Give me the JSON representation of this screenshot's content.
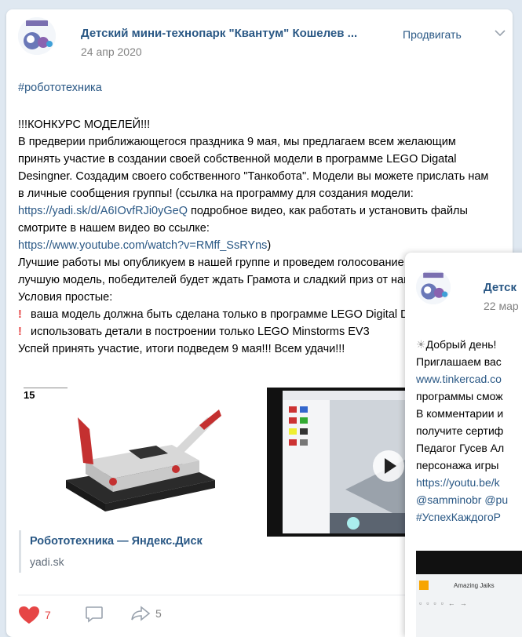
{
  "post1": {
    "author": "Детский мини-технопарк \"Квантум\" Кошелев ...",
    "date": "24 апр 2020",
    "promote_label": "Продвигать",
    "hashtag": "#робототехника",
    "title": "!!!КОНКУРС МОДЕЛЕЙ!!!",
    "para1": "В предверии приближающегося праздника 9 мая, мы предлагаем всем желающим принять участие в создании своей собственной модели в программе LEGO Digatal Desingner. Создадим своего собственного \"Танкобота\". Модели вы можете прислать нам в личные сообщения группы! (ссылка на программу для создания модели: ",
    "link1": "https://yadi.sk/d/A6IOvfRJi0yGeQ",
    "para1b": " подробное видео, как работать и установить файлы смотрите в нашем видео во ссылке:",
    "link2": "https://www.youtube.com/watch?v=RMff_SsRYns",
    "para1c": ")",
    "para2": "Лучшие работы мы опубликуем в нашей группе и проведем голосование за самую лучшую модель, победителей будет ждать Грамота и сладкий приз от нашей команды.",
    "conditions": "Условия простые:",
    "cond1": "ваша модель должна быть сделана только в программе LEGO Digital Designer",
    "cond2": "использовать детали в построении только LEGO Minstorms EV3",
    "closing": "Успей принять участие, итоги подведем 9 мая!!! Всем удачи!!!",
    "robot_label": "15",
    "snippet_title": "Робототехника — Яндекс.Диск",
    "snippet_domain": "yadi.sk",
    "likes": "7",
    "shares": "5",
    "accent": "#2a5885",
    "like_color": "#e64646"
  },
  "post2": {
    "author": "Детск",
    "date": "22 мар",
    "lines": [
      "Добрый день!",
      "Приглашаем вас",
      "www.tinkercad.co",
      "программы смож",
      "В комментарии и",
      "получите сертиф",
      "Педагог Гусев Ал",
      "персонажа игры",
      "https://youtu.be/k",
      "@samminobr @pu",
      "#УспехКаждогоР"
    ],
    "video_title": "Amazing Jaiks"
  }
}
